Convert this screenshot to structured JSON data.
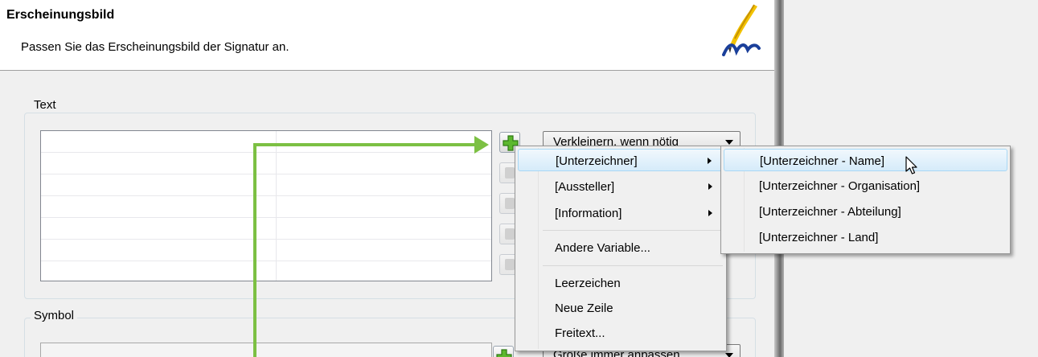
{
  "header": {
    "title": "Erscheinungsbild",
    "subtitle": "Passen Sie das Erscheinungsbild der Signatur an."
  },
  "text_group": {
    "label": "Text",
    "combo_value": "Verkleinern, wenn nötig"
  },
  "symbol_group": {
    "label": "Symbol",
    "combo_value": "Größe immer anpassen"
  },
  "menu": {
    "items": [
      {
        "label": "[Unterzeichner]"
      },
      {
        "label": "[Aussteller]"
      },
      {
        "label": "[Information]"
      },
      {
        "label": "Andere Variable..."
      },
      {
        "label": "Leerzeichen"
      },
      {
        "label": "Neue Zeile"
      },
      {
        "label": "Freitext..."
      }
    ]
  },
  "submenu": {
    "items": [
      {
        "label": "[Unterzeichner - Name]"
      },
      {
        "label": "[Unterzeichner - Organisation]"
      },
      {
        "label": "[Unterzeichner - Abteilung]"
      },
      {
        "label": "[Unterzeichner - Land]"
      }
    ]
  },
  "colors": {
    "accent_arrow": "#7cc043",
    "highlight": "#d5ebfa"
  },
  "icons": {
    "logo": "quill-pen-icon",
    "add": "plus-icon",
    "cursor": "mouse-pointer-icon"
  }
}
